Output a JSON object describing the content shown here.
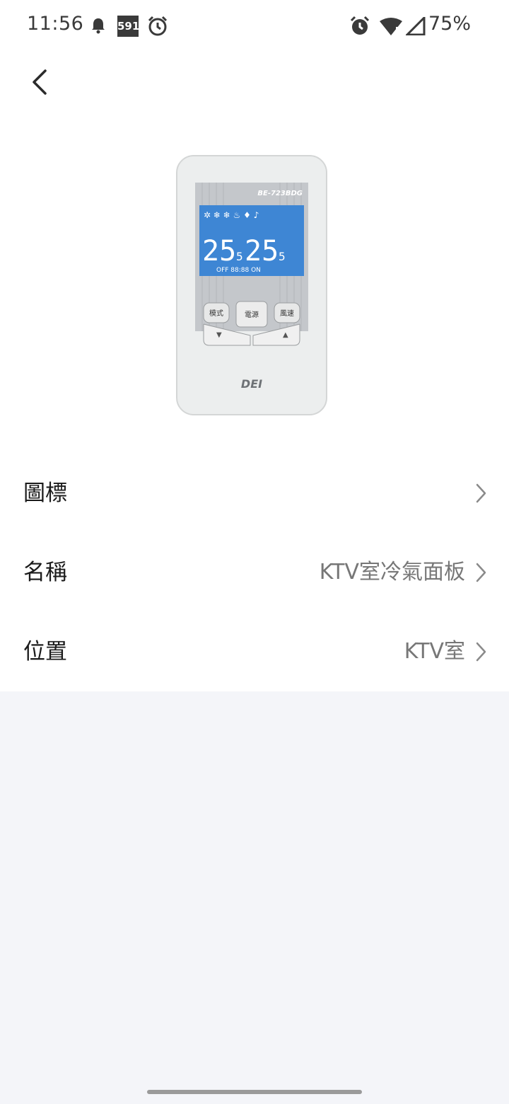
{
  "status_bar": {
    "time": "11:56",
    "notification_badge": "591",
    "battery": "75%",
    "icons": [
      "bell-icon",
      "591-app-icon",
      "alarm-icon",
      "alarm-icon",
      "wifi-icon",
      "signal-icon"
    ]
  },
  "header": {
    "back_icon": "chevron-left-icon"
  },
  "device_image": {
    "model_text": "BE-723BDG",
    "temp_left": "25",
    "temp_left_decimal": "5",
    "temp_right": "25",
    "temp_right_decimal": "5",
    "button_mode": "模式",
    "button_power": "電源",
    "button_fan": "風速",
    "brand": "DEI"
  },
  "settings": [
    {
      "label": "圖標",
      "value": ""
    },
    {
      "label": "名稱",
      "value": "KTV室冷氣面板"
    },
    {
      "label": "位置",
      "value": "KTV室"
    }
  ],
  "colors": {
    "page_bg": "#f4f5f9",
    "card_bg": "#ffffff",
    "lcd_blue": "#3e86d4"
  }
}
